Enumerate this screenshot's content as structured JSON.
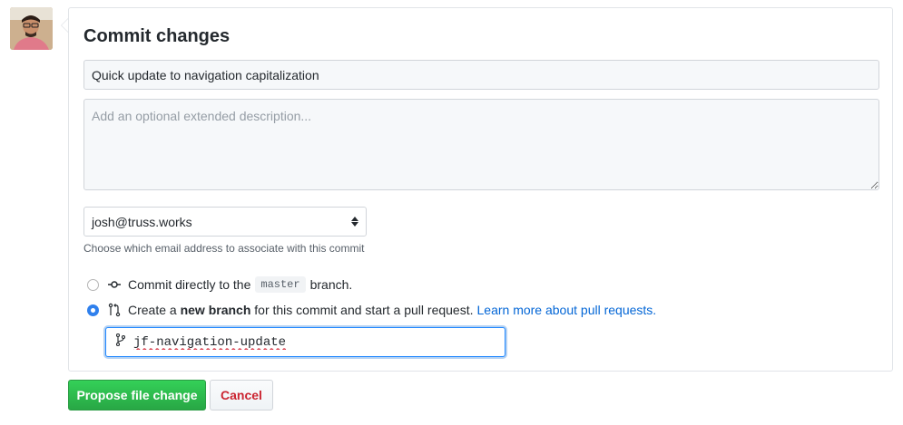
{
  "commit": {
    "title": "Commit changes",
    "summary_value": "Quick update to navigation capitalization",
    "description_placeholder": "Add an optional extended description...",
    "email": {
      "selected": "josh@truss.works",
      "helper": "Choose which email address to associate with this commit"
    },
    "options": {
      "direct": {
        "prefix": "Commit directly to the",
        "branch": "master",
        "suffix": "branch.",
        "checked": false
      },
      "new_branch": {
        "prefix": "Create a",
        "bold": "new branch",
        "suffix": "for this commit and start a pull request.",
        "link": "Learn more about pull requests.",
        "checked": true
      }
    },
    "branch_name_value": "jf-navigation-update",
    "buttons": {
      "propose": "Propose file change",
      "cancel": "Cancel"
    }
  },
  "colors": {
    "primary_green": "#28a745",
    "link_blue": "#0366d6",
    "cancel_red": "#cb2431",
    "radio_blue": "#2f80ed"
  },
  "icons": {
    "commit": "git-commit-icon",
    "pull_request": "git-pull-request-icon",
    "branch": "git-branch-icon"
  }
}
